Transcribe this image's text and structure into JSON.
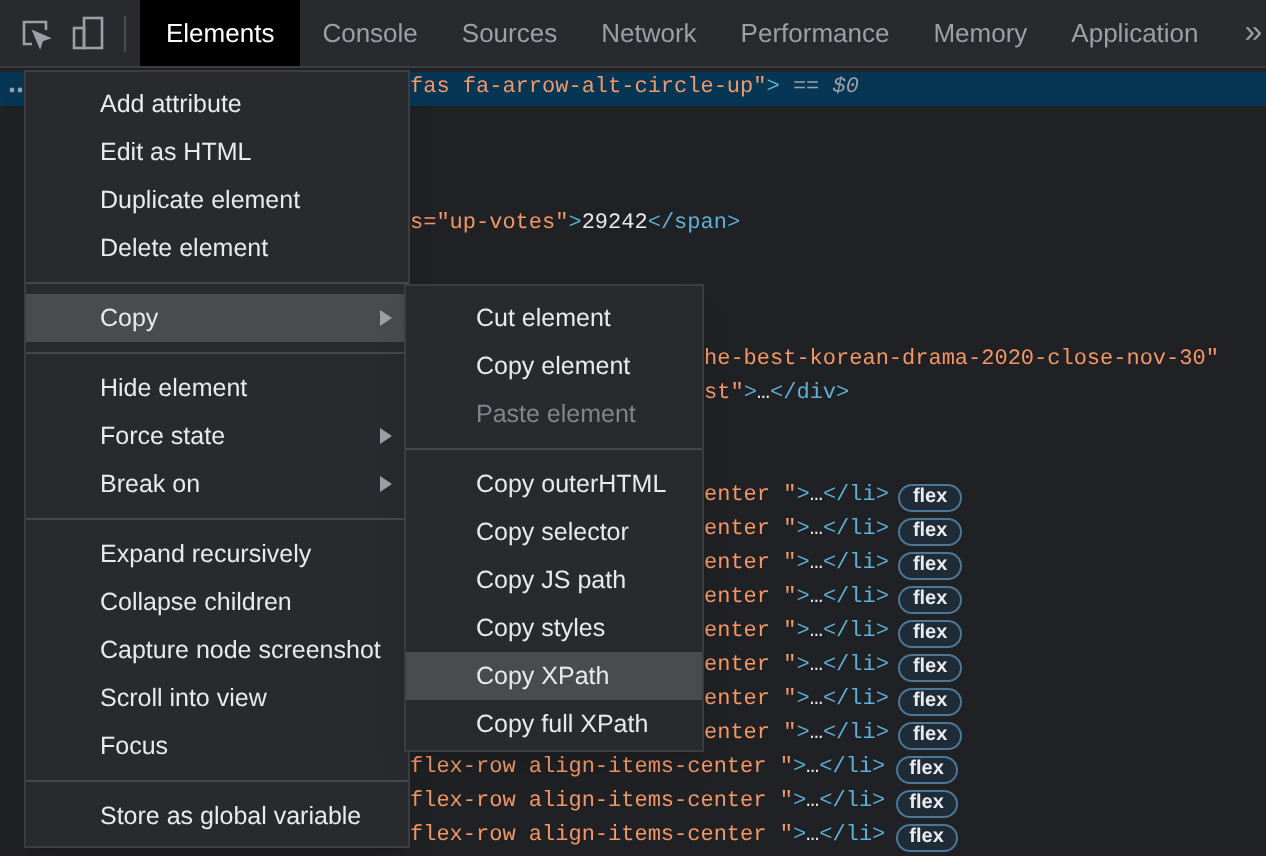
{
  "toolbar": {
    "tabs": [
      {
        "label": "Elements",
        "selected": true
      },
      {
        "label": "Console",
        "selected": false
      },
      {
        "label": "Sources",
        "selected": false
      },
      {
        "label": "Network",
        "selected": false
      },
      {
        "label": "Performance",
        "selected": false
      },
      {
        "label": "Memory",
        "selected": false
      },
      {
        "label": "Application",
        "selected": false
      }
    ],
    "more": "»"
  },
  "code": {
    "lines": [
      {
        "kind": "after_menu",
        "selected": true,
        "segments": [
          {
            "kind": "value",
            "text": "fas fa-arrow-alt-circle-up\""
          },
          {
            "kind": "tag",
            "text": ">"
          },
          {
            "kind": "muted",
            "text": " == "
          },
          {
            "kind": "ref",
            "text": "$0"
          }
        ]
      },
      {
        "kind": "covered"
      },
      {
        "kind": "covered"
      },
      {
        "kind": "covered"
      },
      {
        "kind": "after_menu",
        "selected": false,
        "segments": [
          {
            "kind": "value",
            "text": "s=\"up-votes\""
          },
          {
            "kind": "tag",
            "text": ">"
          },
          {
            "kind": "plain",
            "text": "29242"
          },
          {
            "kind": "tag",
            "text": "</span>"
          }
        ]
      },
      {
        "kind": "covered"
      },
      {
        "kind": "covered"
      },
      {
        "kind": "covered"
      },
      {
        "kind": "after_submenu",
        "selected": false,
        "segments": [
          {
            "kind": "value",
            "text": "he-best-korean-drama-2020-close-nov-30\""
          }
        ]
      },
      {
        "kind": "after_submenu",
        "selected": false,
        "segments": [
          {
            "kind": "value",
            "text": "st\""
          },
          {
            "kind": "tag",
            "text": ">"
          },
          {
            "kind": "plain",
            "text": "…"
          },
          {
            "kind": "tag",
            "text": "</div>"
          }
        ]
      },
      {
        "kind": "covered"
      },
      {
        "kind": "covered"
      },
      {
        "kind": "after_submenu",
        "selected": false,
        "segments": [
          {
            "kind": "value",
            "text": "enter \""
          },
          {
            "kind": "tag",
            "text": ">"
          },
          {
            "kind": "plain",
            "text": "…"
          },
          {
            "kind": "tag",
            "text": "</li>"
          }
        ],
        "badge": "flex"
      },
      {
        "kind": "after_submenu",
        "selected": false,
        "segments": [
          {
            "kind": "value",
            "text": "enter \""
          },
          {
            "kind": "tag",
            "text": ">"
          },
          {
            "kind": "plain",
            "text": "…"
          },
          {
            "kind": "tag",
            "text": "</li>"
          }
        ],
        "badge": "flex"
      },
      {
        "kind": "after_submenu",
        "selected": false,
        "segments": [
          {
            "kind": "value",
            "text": "enter \""
          },
          {
            "kind": "tag",
            "text": ">"
          },
          {
            "kind": "plain",
            "text": "…"
          },
          {
            "kind": "tag",
            "text": "</li>"
          }
        ],
        "badge": "flex"
      },
      {
        "kind": "after_submenu",
        "selected": false,
        "segments": [
          {
            "kind": "value",
            "text": "enter \""
          },
          {
            "kind": "tag",
            "text": ">"
          },
          {
            "kind": "plain",
            "text": "…"
          },
          {
            "kind": "tag",
            "text": "</li>"
          }
        ],
        "badge": "flex"
      },
      {
        "kind": "after_submenu",
        "selected": false,
        "segments": [
          {
            "kind": "value",
            "text": "enter \""
          },
          {
            "kind": "tag",
            "text": ">"
          },
          {
            "kind": "plain",
            "text": "…"
          },
          {
            "kind": "tag",
            "text": "</li>"
          }
        ],
        "badge": "flex"
      },
      {
        "kind": "after_submenu",
        "selected": false,
        "segments": [
          {
            "kind": "value",
            "text": "enter \""
          },
          {
            "kind": "tag",
            "text": ">"
          },
          {
            "kind": "plain",
            "text": "…"
          },
          {
            "kind": "tag",
            "text": "</li>"
          }
        ],
        "badge": "flex"
      },
      {
        "kind": "after_submenu",
        "selected": false,
        "segments": [
          {
            "kind": "value",
            "text": "enter \""
          },
          {
            "kind": "tag",
            "text": ">"
          },
          {
            "kind": "plain",
            "text": "…"
          },
          {
            "kind": "tag",
            "text": "</li>"
          }
        ],
        "badge": "flex"
      },
      {
        "kind": "after_submenu",
        "selected": false,
        "segments": [
          {
            "kind": "value",
            "text": "enter \""
          },
          {
            "kind": "tag",
            "text": ">"
          },
          {
            "kind": "plain",
            "text": "…"
          },
          {
            "kind": "tag",
            "text": "</li>"
          }
        ],
        "badge": "flex"
      },
      {
        "kind": "after_menu",
        "selected": false,
        "segments": [
          {
            "kind": "value",
            "text": "flex-row align-items-center \""
          },
          {
            "kind": "tag",
            "text": ">"
          },
          {
            "kind": "plain",
            "text": "…"
          },
          {
            "kind": "tag",
            "text": "</li>"
          }
        ],
        "badge": "flex"
      },
      {
        "kind": "after_menu",
        "selected": false,
        "segments": [
          {
            "kind": "value",
            "text": "flex-row align-items-center \""
          },
          {
            "kind": "tag",
            "text": ">"
          },
          {
            "kind": "plain",
            "text": "…"
          },
          {
            "kind": "tag",
            "text": "</li>"
          }
        ],
        "badge": "flex"
      },
      {
        "kind": "after_menu",
        "selected": false,
        "segments": [
          {
            "kind": "value",
            "text": "flex-row align-items-center \""
          },
          {
            "kind": "tag",
            "text": ">"
          },
          {
            "kind": "plain",
            "text": "…"
          },
          {
            "kind": "tag",
            "text": "</li>"
          }
        ],
        "badge": "flex"
      }
    ]
  },
  "context_menu": {
    "groups": [
      [
        {
          "label": "Add attribute",
          "selected": false,
          "disabled": false,
          "submenu": false
        },
        {
          "label": "Edit as HTML",
          "selected": false,
          "disabled": false,
          "submenu": false
        },
        {
          "label": "Duplicate element",
          "selected": false,
          "disabled": false,
          "submenu": false
        },
        {
          "label": "Delete element",
          "selected": false,
          "disabled": false,
          "submenu": false
        }
      ],
      [
        {
          "label": "Copy",
          "selected": true,
          "disabled": false,
          "submenu": true
        }
      ],
      [
        {
          "label": "Hide element",
          "selected": false,
          "disabled": false,
          "submenu": false
        },
        {
          "label": "Force state",
          "selected": false,
          "disabled": false,
          "submenu": true
        },
        {
          "label": "Break on",
          "selected": false,
          "disabled": false,
          "submenu": true
        }
      ],
      [
        {
          "label": "Expand recursively",
          "selected": false,
          "disabled": false,
          "submenu": false
        },
        {
          "label": "Collapse children",
          "selected": false,
          "disabled": false,
          "submenu": false
        },
        {
          "label": "Capture node screenshot",
          "selected": false,
          "disabled": false,
          "submenu": false
        },
        {
          "label": "Scroll into view",
          "selected": false,
          "disabled": false,
          "submenu": false
        },
        {
          "label": "Focus",
          "selected": false,
          "disabled": false,
          "submenu": false
        }
      ],
      [
        {
          "label": "Store as global variable",
          "selected": false,
          "disabled": false,
          "submenu": false
        }
      ]
    ]
  },
  "copy_submenu": {
    "groups": [
      [
        {
          "label": "Cut element",
          "selected": false,
          "disabled": false,
          "submenu": false
        },
        {
          "label": "Copy element",
          "selected": false,
          "disabled": false,
          "submenu": false
        },
        {
          "label": "Paste element",
          "selected": false,
          "disabled": true,
          "submenu": false
        }
      ],
      [
        {
          "label": "Copy outerHTML",
          "selected": false,
          "disabled": false,
          "submenu": false
        },
        {
          "label": "Copy selector",
          "selected": false,
          "disabled": false,
          "submenu": false
        },
        {
          "label": "Copy JS path",
          "selected": false,
          "disabled": false,
          "submenu": false
        },
        {
          "label": "Copy styles",
          "selected": false,
          "disabled": false,
          "submenu": false
        },
        {
          "label": "Copy XPath",
          "selected": true,
          "disabled": false,
          "submenu": false
        },
        {
          "label": "Copy full XPath",
          "selected": false,
          "disabled": false,
          "submenu": false
        }
      ]
    ]
  }
}
